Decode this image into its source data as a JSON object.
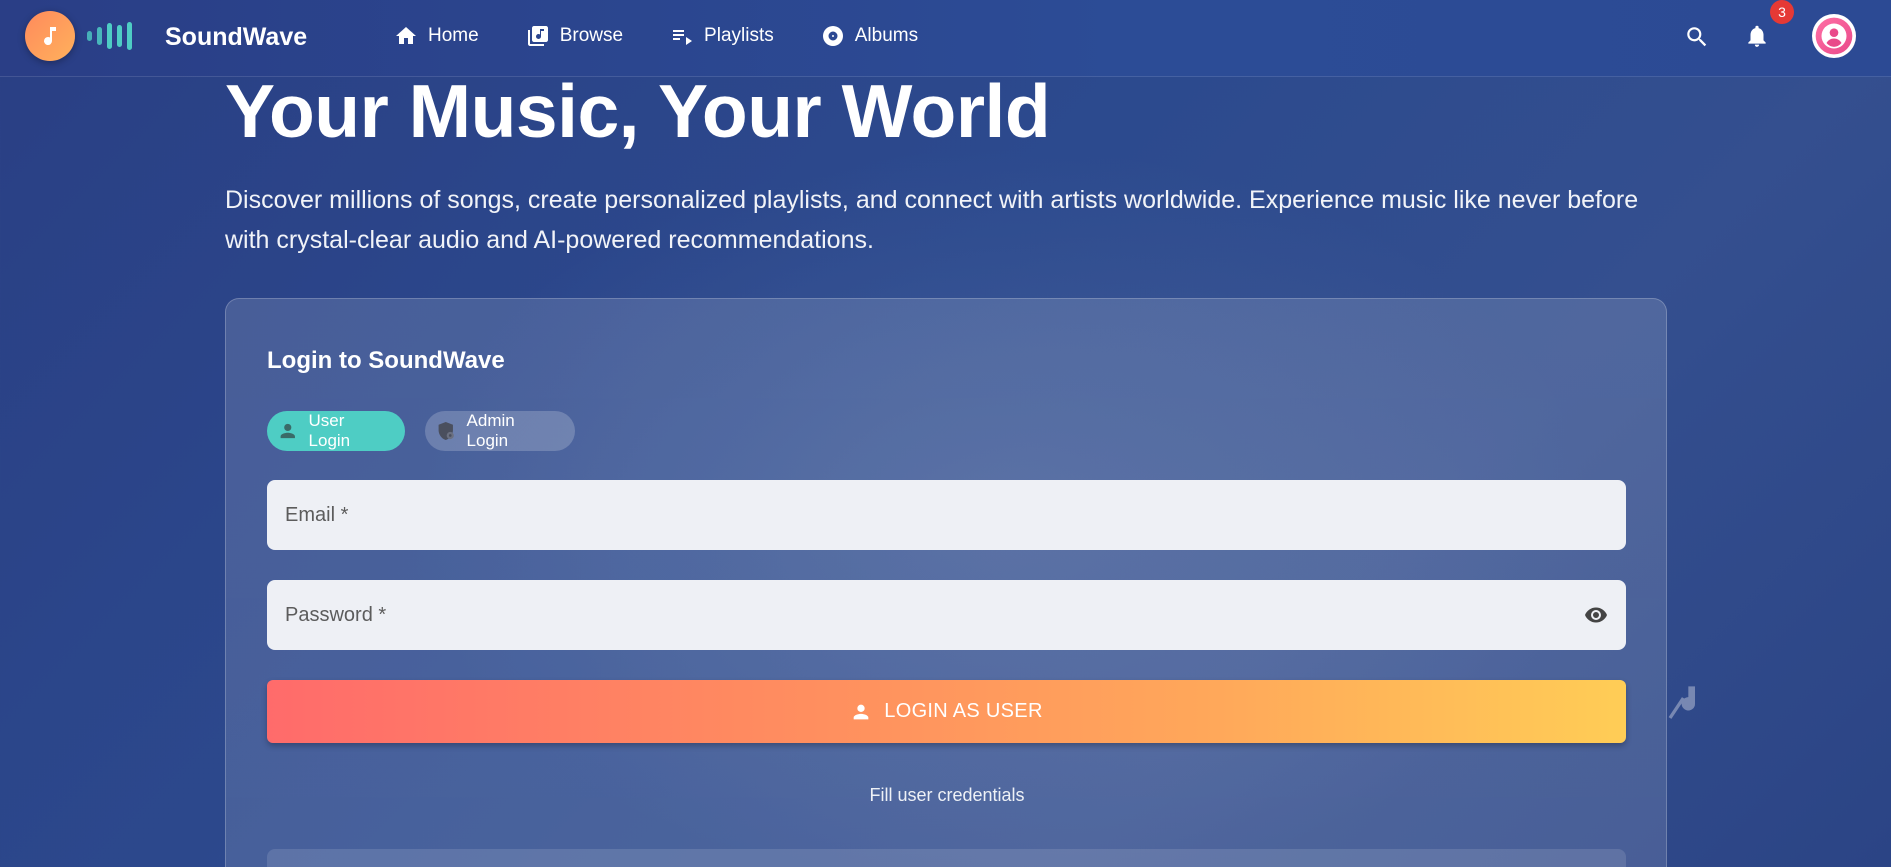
{
  "header": {
    "brand": "SoundWave",
    "nav": [
      {
        "label": "Home",
        "icon": "home-icon"
      },
      {
        "label": "Browse",
        "icon": "library-music-icon"
      },
      {
        "label": "Playlists",
        "icon": "playlist-play-icon"
      },
      {
        "label": "Albums",
        "icon": "album-icon"
      }
    ],
    "notification_count": "3",
    "icons": [
      "music-note-icon",
      "search-icon",
      "bell-icon",
      "account-icon"
    ]
  },
  "hero": {
    "title": "Your Music, Your World",
    "subtitle": "Discover millions of songs, create personalized playlists, and connect with artists worldwide. Experience music like never before with crystal-clear audio and AI-powered recommendations."
  },
  "login": {
    "title": "Login to SoundWave",
    "tabs": [
      {
        "label": "User Login",
        "active": true
      },
      {
        "label": "Admin Login",
        "active": false
      }
    ],
    "email_placeholder": "Email *",
    "password_placeholder": "Password *",
    "submit_label": "LOGIN AS USER",
    "hint": "Fill user credentials"
  },
  "colors": {
    "accent_teal": "#4ecdc4",
    "gradient_start": "#ff6b6b",
    "gradient_end": "#ffcd56",
    "badge": "#e53935"
  }
}
